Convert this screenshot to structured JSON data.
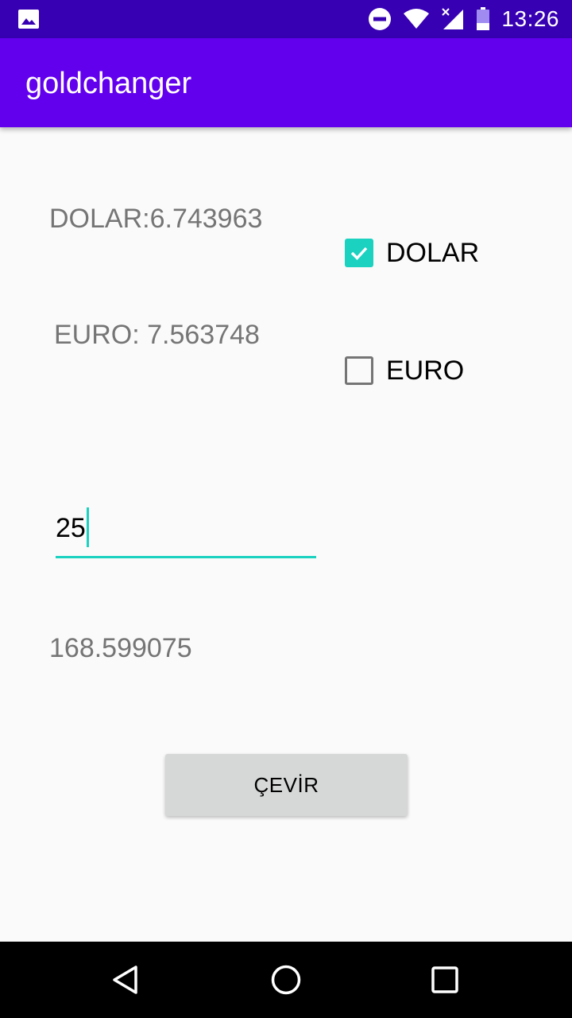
{
  "status_bar": {
    "time": "13:26",
    "icons": [
      "image-icon",
      "do-not-disturb-icon",
      "wifi-icon",
      "signal-icon",
      "battery-icon"
    ]
  },
  "app_bar": {
    "title": "goldchanger",
    "color": "#6200ee"
  },
  "rates": {
    "dolar_text": "DOLAR:6.743963",
    "euro_text": "EURO: 7.563748"
  },
  "options": [
    {
      "label": "DOLAR",
      "checked": true
    },
    {
      "label": "EURO",
      "checked": false
    }
  ],
  "input": {
    "value": "25",
    "accent": "#1bd1c0"
  },
  "result": {
    "value": "168.599075"
  },
  "button": {
    "label": "ÇEVİR"
  },
  "nav_bar": {
    "icons": [
      "back-icon",
      "home-icon",
      "recent-apps-icon"
    ]
  }
}
